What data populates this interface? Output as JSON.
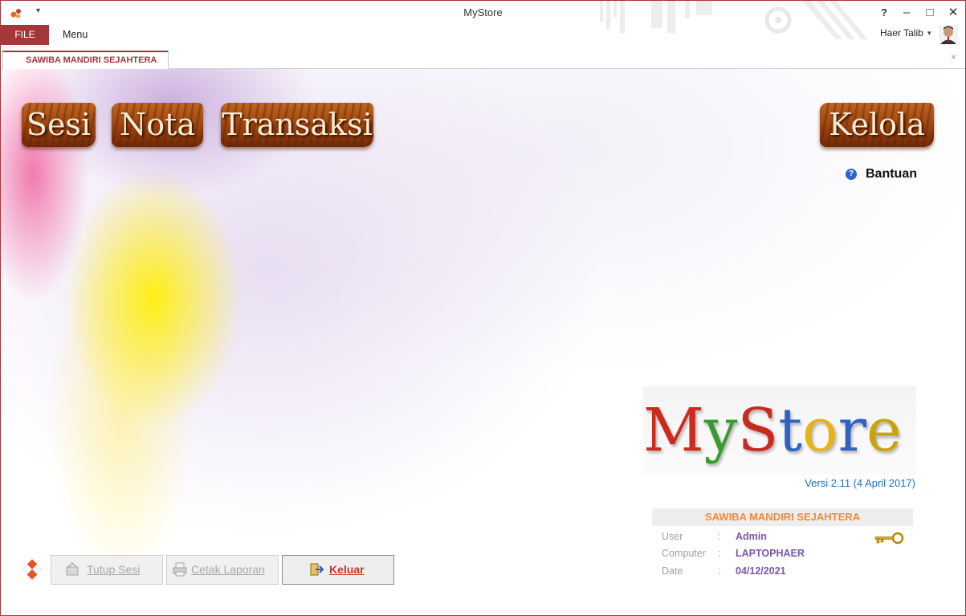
{
  "window": {
    "title": "MyStore"
  },
  "titlebar": {
    "qa_caret": "▾",
    "help": "?",
    "minimize": "–",
    "maximize": "□",
    "close": "✕"
  },
  "ribbon": {
    "file_label": "FILE",
    "menu_label": "Menu",
    "user_name": "Haer Talib",
    "user_caret": "▾"
  },
  "doc_tab": {
    "label": "SAWIBA MANDIRI SEJAHTERA",
    "close": "×"
  },
  "nav": {
    "sesi": "Sesi",
    "nota": "Nota",
    "transaksi": "Transaksi",
    "kelola": "Kelola"
  },
  "help": {
    "icon": "?",
    "label": "Bantuan"
  },
  "logo": {
    "letters": [
      "M",
      "y",
      "S",
      "t",
      "o",
      "r",
      "e"
    ],
    "colors": [
      "#cc2a1c",
      "#3a9a32",
      "#c82a1c",
      "#2f62c4",
      "#e8b216",
      "#2f62c4",
      "#c8a40a"
    ]
  },
  "version": "Versi 2.11 (4 April 2017)",
  "session": {
    "company": "SAWIBA MANDIRI SEJAHTERA",
    "colon": ":",
    "user_label": "User",
    "user_value": "Admin",
    "computer_label": "Computer",
    "computer_value": "LAPTOPHAER",
    "date_label": "Date",
    "date_value": "04/12/2021"
  },
  "buttons": {
    "tutup_sesi": "Tutup Sesi",
    "cetak_laporan": "Cetak Laporan",
    "keluar": "Keluar"
  },
  "colors": {
    "accent": "#a4373a",
    "company_text": "#f08a3c",
    "info_value": "#7a56a6",
    "version_text": "#1c6fbf",
    "exit_text": "#c8372e"
  }
}
